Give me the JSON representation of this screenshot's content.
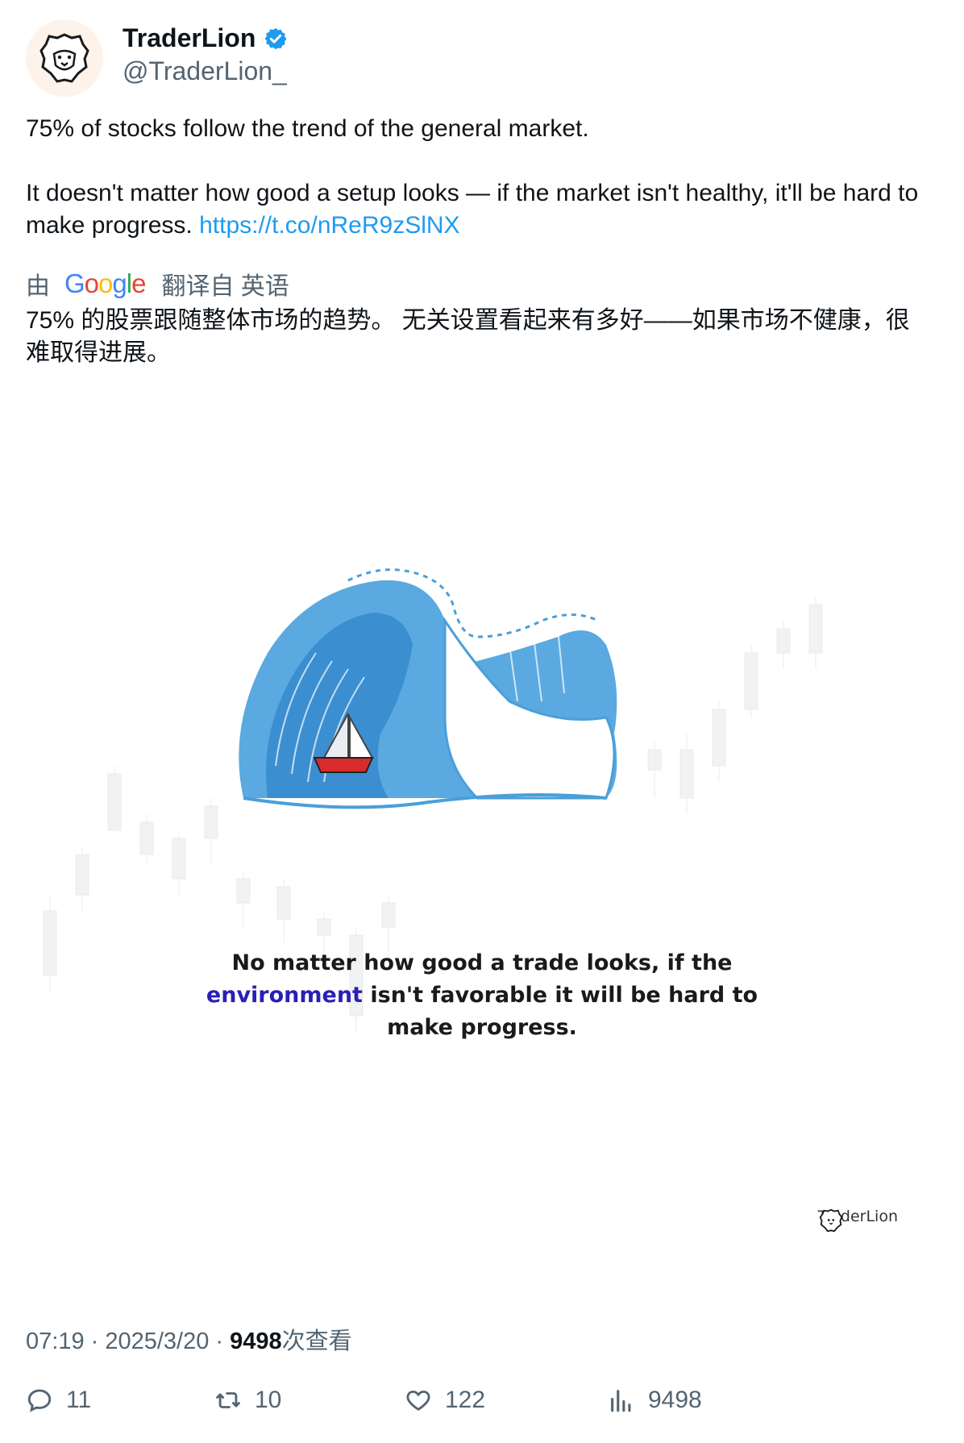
{
  "author": {
    "display_name": "TraderLion",
    "handle": "@TraderLion_",
    "verified": true
  },
  "tweet": {
    "line1": "75% of stocks follow the trend of the general market.",
    "line2": "It doesn't matter how good a setup looks — if the market isn't healthy, it'll be hard to make progress.",
    "link": "https://t.co/nReR9zSlNX"
  },
  "translation": {
    "prefix": "由",
    "provider": "Google",
    "suffix": "翻译自 英语",
    "text": "75% 的股票跟随整体市场的趋势。 无关设置看起来有多好——如果市场不健康，很难取得进展。"
  },
  "media": {
    "caption_line1": "No matter how good a trade looks, if the",
    "caption_accent": "environment",
    "caption_line2_rest": " isn't favorable it will be hard to",
    "caption_line3": "make progress.",
    "brand": "TraderLion"
  },
  "meta": {
    "time": "07:19",
    "sep": " · ",
    "date": "2025/3/20",
    "views_count": "9498",
    "views_label": "次查看"
  },
  "actions": {
    "replies": "11",
    "retweets": "10",
    "likes": "122",
    "views": "9498"
  },
  "colors": {
    "link": "#1d9bf0",
    "verified": "#1d9bf0",
    "caption_accent": "#2a1fb5",
    "wave": "#4a9fd8",
    "boat": "#d92b2b"
  }
}
